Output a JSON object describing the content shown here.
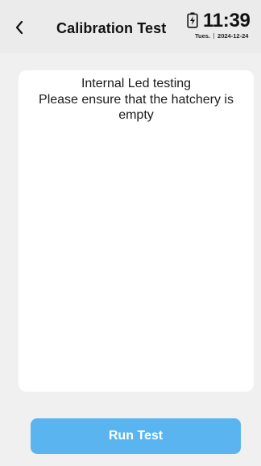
{
  "header": {
    "title": "Calibration Test",
    "back_icon": "chevron-left-icon",
    "battery_icon": "battery-charging-icon"
  },
  "status": {
    "time": "11:39",
    "day": "Tues.",
    "date": "2024-12-24"
  },
  "card": {
    "lines": [
      "Internal Led testing",
      "Please ensure that the hatchery is",
      "empty"
    ]
  },
  "actions": {
    "run_test_label": "Run Test"
  },
  "colors": {
    "background": "#f0f0f0",
    "header_background": "#ebebeb",
    "card_background": "#ffffff",
    "primary_button": "#5ab4f0",
    "text": "#111111"
  }
}
